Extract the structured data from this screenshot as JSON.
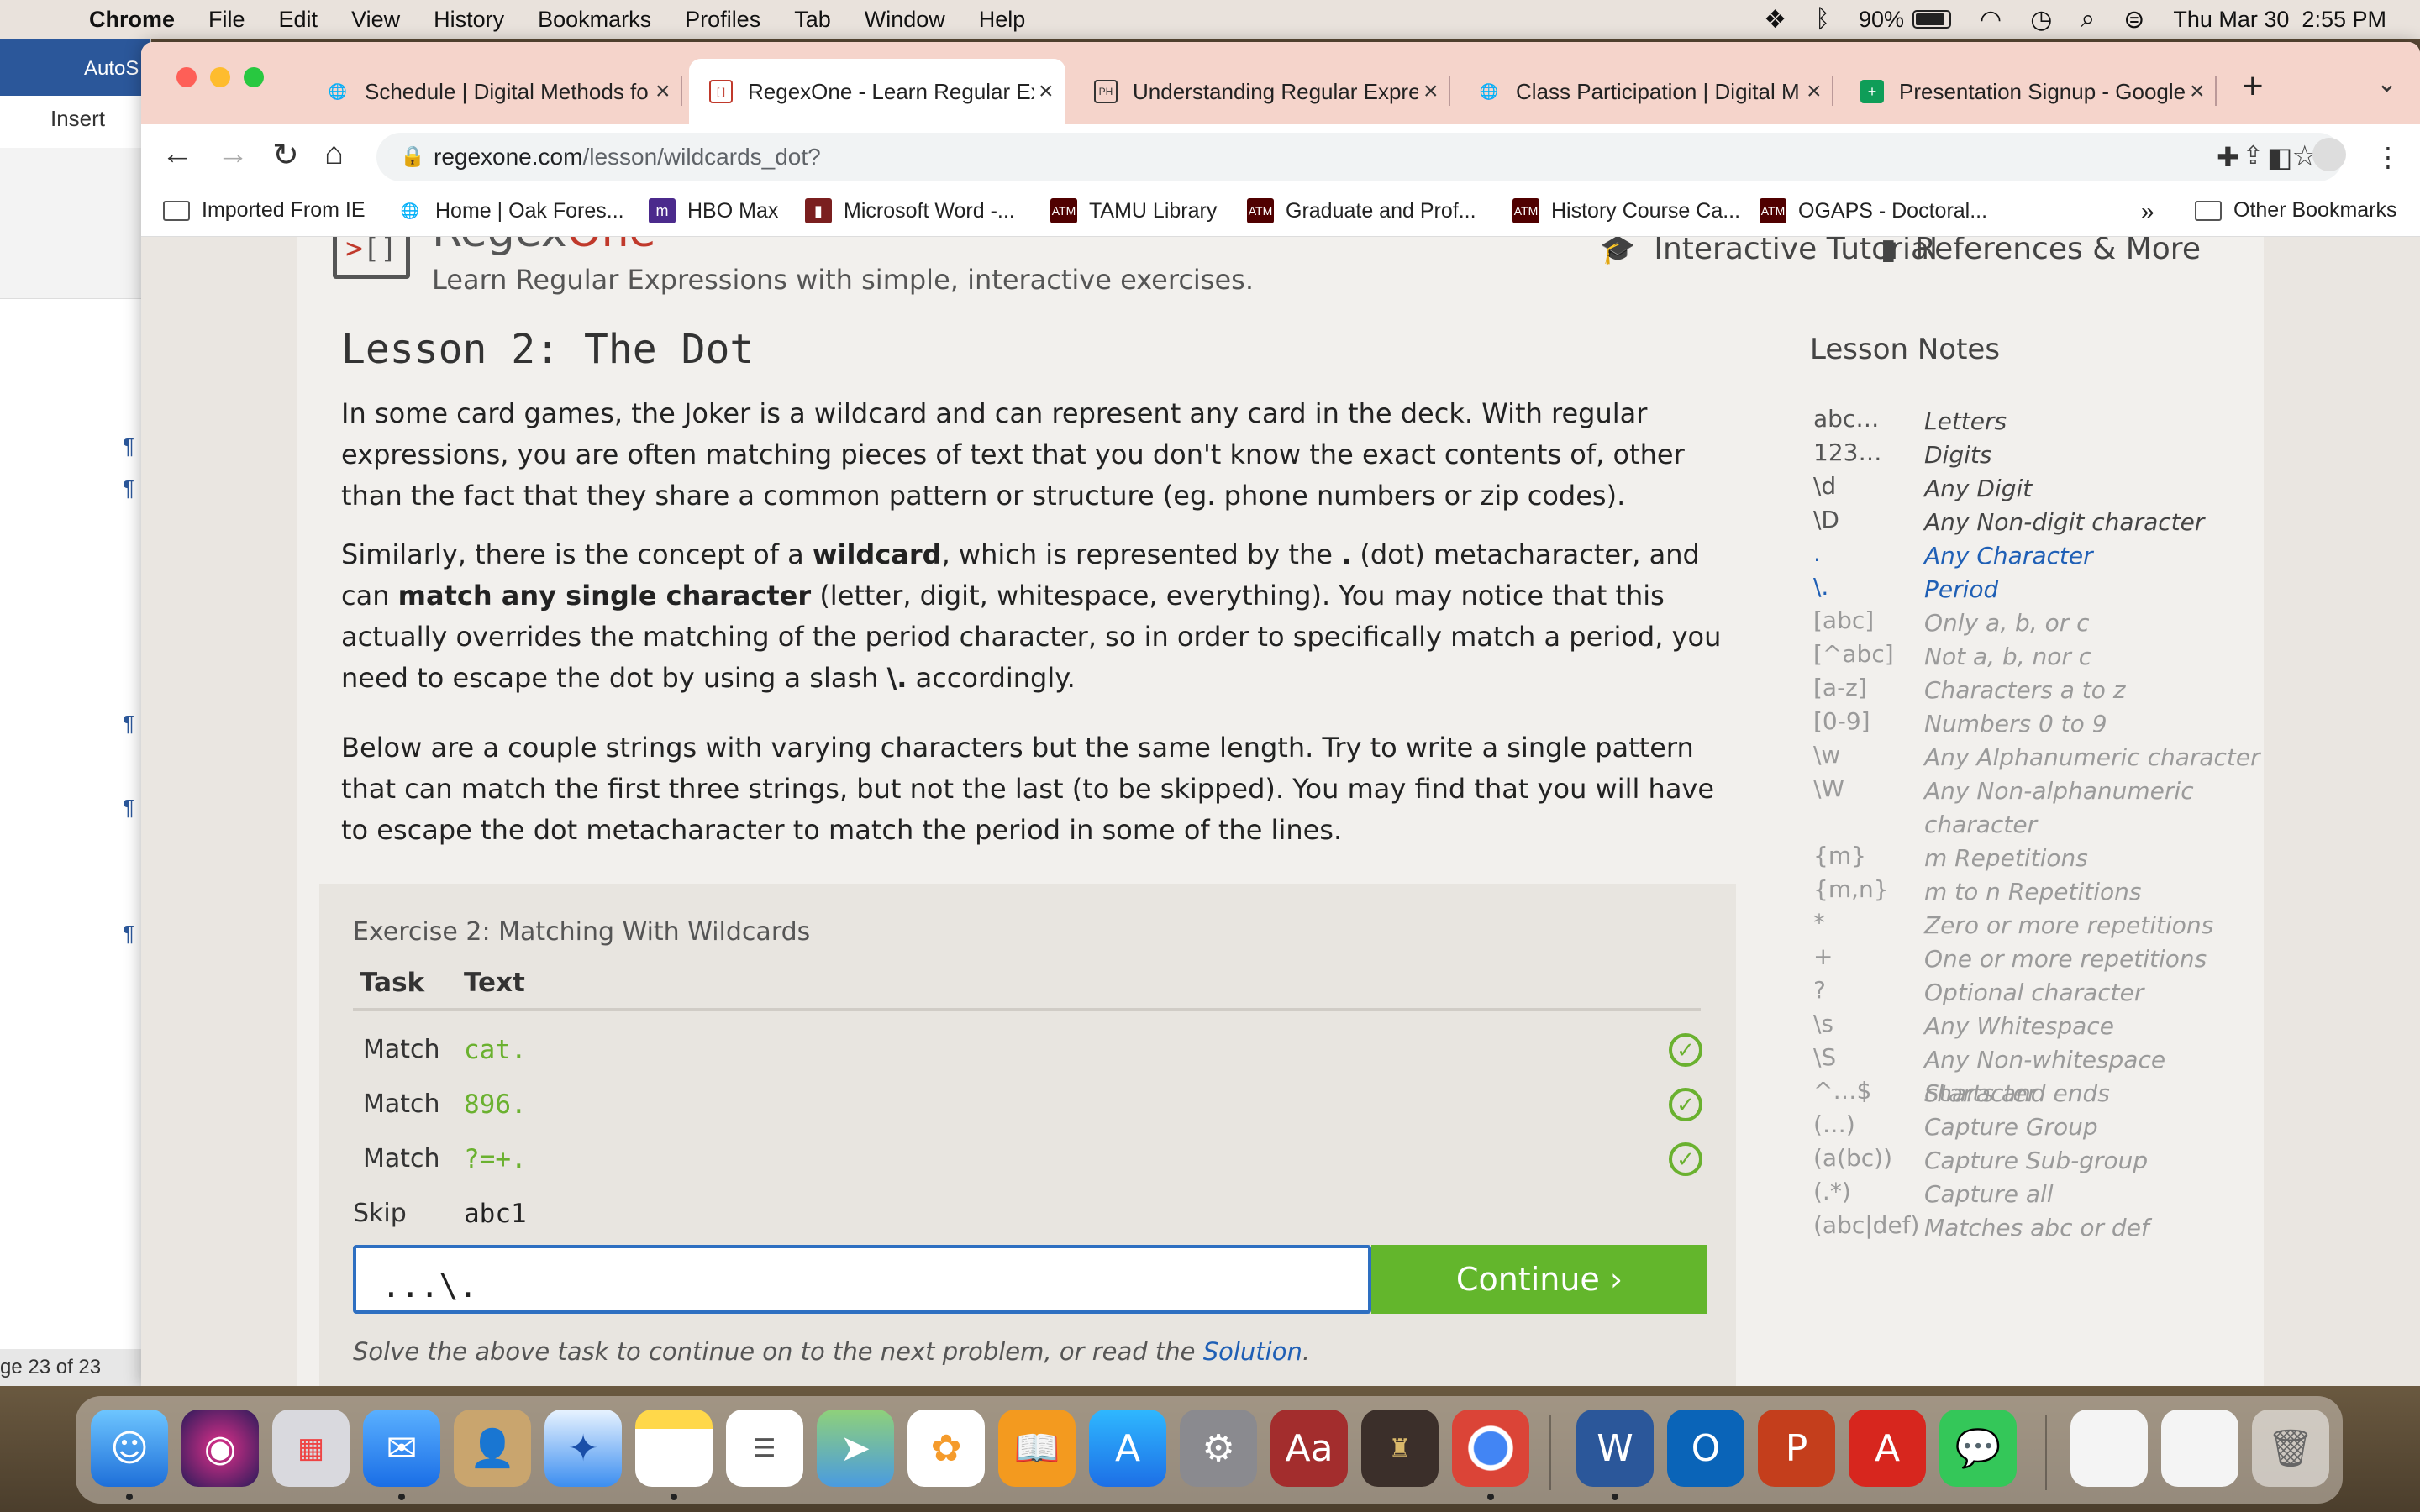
{
  "menubar": {
    "app": "Chrome",
    "items": [
      "File",
      "Edit",
      "View",
      "History",
      "Bookmarks",
      "Profiles",
      "Tab",
      "Window",
      "Help"
    ],
    "battery": "90%",
    "clock": "Thu Mar 30  2:55 PM"
  },
  "word": {
    "title": "AutoS",
    "tab_label": "Insert",
    "status": "ge 23 of 23"
  },
  "tabs": [
    {
      "label": "Schedule | Digital Methods fo",
      "active": false
    },
    {
      "label": "RegexOne - Learn Regular Ex",
      "active": true
    },
    {
      "label": "Understanding Regular Expre",
      "active": false
    },
    {
      "label": "Class Participation | Digital M",
      "active": false
    },
    {
      "label": "Presentation Signup - Google",
      "active": false
    }
  ],
  "address": {
    "host": "regexone.com",
    "path": "/lesson/wildcards_dot?"
  },
  "bookmarks": [
    "Imported From IE",
    "Home | Oak Fores...",
    "HBO Max",
    "Microsoft Word -...",
    "TAMU Library",
    "Graduate and Prof...",
    "History Course Ca...",
    "OGAPS - Doctoral..."
  ],
  "bookmarks_overflow": "»",
  "other_bookmarks": "Other Bookmarks",
  "site": {
    "brand_a": "Regex",
    "brand_b": "One",
    "tagline": "Learn Regular Expressions with simple, interactive exercises.",
    "nav_tutorial": "Interactive Tutorial",
    "nav_references": "References & More"
  },
  "lesson": {
    "title": "Lesson 2: The Dot",
    "p1": "In some card games, the Joker is a wildcard and can represent any card in the deck. With regular expressions, you are often matching pieces of text that you don't know the exact contents of, other than the fact that they share a common pattern or structure (eg. phone numbers or zip codes).",
    "p2_a": "Similarly, there is the concept of a ",
    "p2_b": "wildcard",
    "p2_c": ", which is represented by the ",
    "p2_d": ".",
    "p2_e": " (dot) metacharacter, and can ",
    "p2_f": "match any single character",
    "p2_g": " (letter, digit, whitespace, everything). You may notice that this actually overrides the matching of the period character, so in order to specifically match a period, you need to escape the dot by using a slash ",
    "p2_h": "\\.",
    "p2_i": " accordingly.",
    "p3": "Below are a couple strings with varying characters but the same length. Try to write a single pattern that can match the first three strings, but not the last (to be skipped). You may find that you will have to escape the dot metacharacter to match the period in some of the lines."
  },
  "exercise": {
    "title": "Exercise 2: Matching With Wildcards",
    "col_task": "Task",
    "col_text": "Text",
    "rows": [
      {
        "task": "Match",
        "text": "cat.",
        "passed": true
      },
      {
        "task": "Match",
        "text": "896.",
        "passed": true
      },
      {
        "task": "Match",
        "text": "?=+.",
        "passed": true
      },
      {
        "task": "Skip",
        "text": "abc1",
        "passed": false
      }
    ],
    "pattern": "...\\.",
    "continue_label": "Continue ›",
    "note_pre": "Solve the above task to continue on to the next problem, or read the ",
    "note_link": "Solution",
    "note_post": "."
  },
  "notes": {
    "title": "Lesson Notes",
    "items": [
      {
        "k": "abc…",
        "v": "Letters"
      },
      {
        "k": "123…",
        "v": "Digits"
      },
      {
        "k": "\\d",
        "v": "Any Digit"
      },
      {
        "k": "\\D",
        "v": "Any Non-digit character"
      },
      {
        "k": ".",
        "v": "Any Character"
      },
      {
        "k": "\\.",
        "v": "Period"
      },
      {
        "k": "[abc]",
        "v": "Only a, b, or c"
      },
      {
        "k": "[^abc]",
        "v": "Not a, b, nor c"
      },
      {
        "k": "[a-z]",
        "v": "Characters a to z"
      },
      {
        "k": "[0-9]",
        "v": "Numbers 0 to 9"
      },
      {
        "k": "\\w",
        "v": "Any Alphanumeric character"
      },
      {
        "k": "\\W",
        "v": "Any Non-alphanumeric character"
      },
      {
        "k": "{m}",
        "v": "m Repetitions"
      },
      {
        "k": "{m,n}",
        "v": "m to n Repetitions"
      },
      {
        "k": "*",
        "v": "Zero or more repetitions"
      },
      {
        "k": "+",
        "v": "One or more repetitions"
      },
      {
        "k": "?",
        "v": "Optional character"
      },
      {
        "k": "\\s",
        "v": "Any Whitespace"
      },
      {
        "k": "\\S",
        "v": "Any Non-whitespace character"
      },
      {
        "k": "^…$",
        "v": "Starts and ends"
      },
      {
        "k": "(…)",
        "v": "Capture Group"
      },
      {
        "k": "(a(bc))",
        "v": "Capture Sub-group"
      },
      {
        "k": "(.*)",
        "v": "Capture all"
      },
      {
        "k": "(abc|def)",
        "v": "Matches abc or def"
      }
    ]
  },
  "colors": {
    "accent_green": "#63b62c",
    "link_blue": "#1f5fb5",
    "brand_red": "#c0392b"
  },
  "dock": {
    "acrobat_glyph": "A",
    "dictionary_glyph": "Aa",
    "word_glyph": "W",
    "outlook_glyph": "O",
    "powerpoint_glyph": "P"
  }
}
